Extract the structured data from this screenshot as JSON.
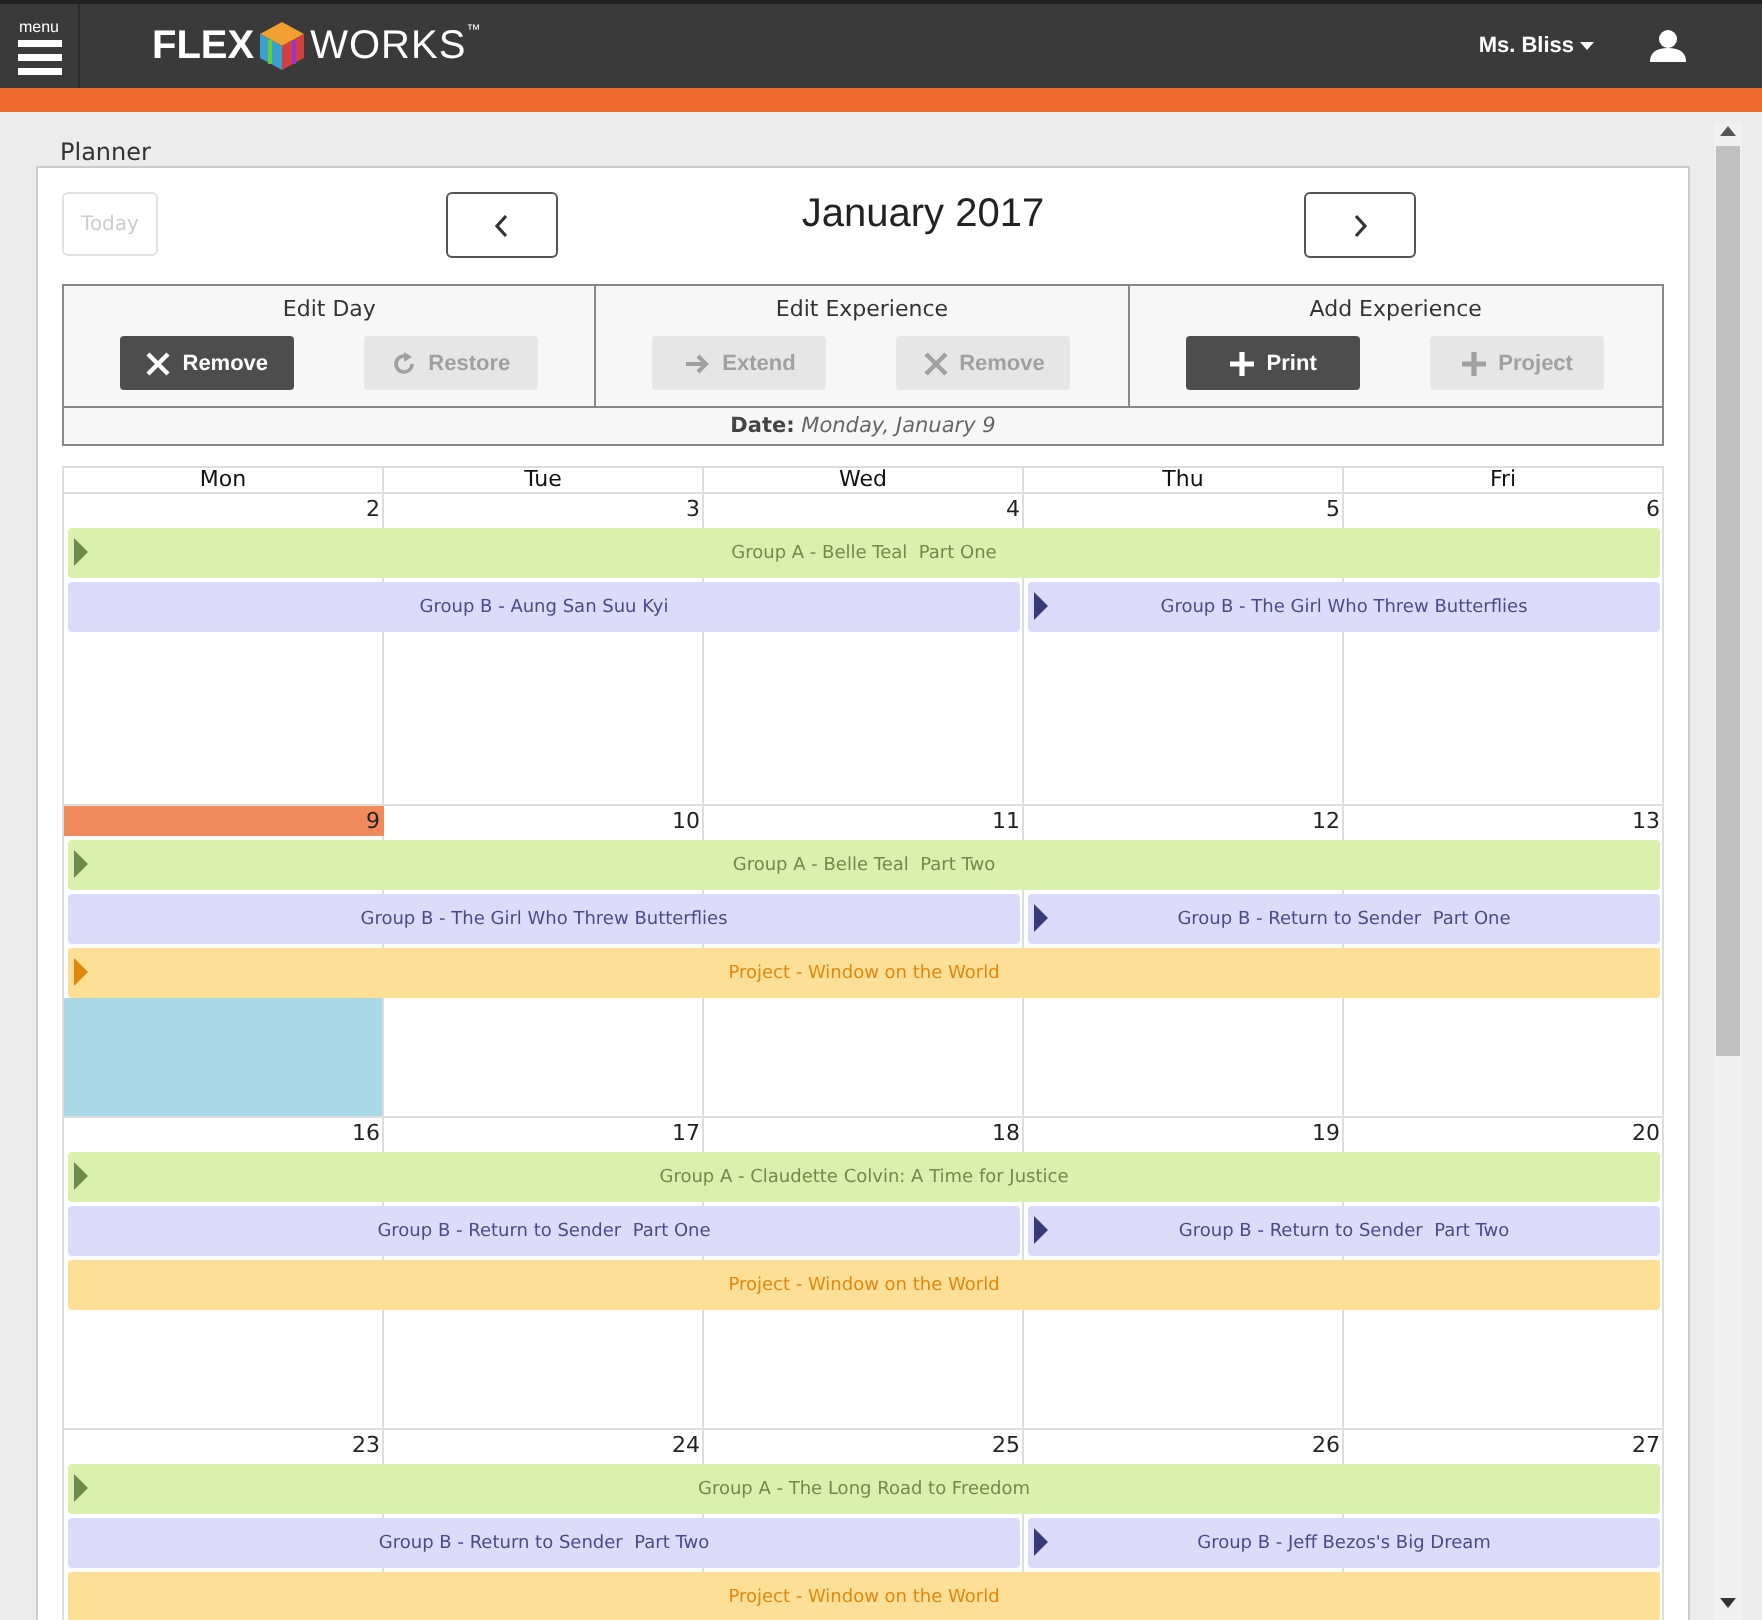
{
  "header": {
    "menu_label": "menu",
    "logo_bold": "FLEX",
    "logo_light": "WORKS",
    "logo_mark": "™",
    "user_name": "Ms. Bliss"
  },
  "page_title": "Planner",
  "toolbar": {
    "today": {
      "label": "Today",
      "disabled": true
    },
    "month": "January 2017"
  },
  "panels": [
    {
      "title": "Edit Day",
      "buttons": [
        {
          "label": "Remove",
          "kind": "remove",
          "disabled": false
        },
        {
          "label": "Restore",
          "kind": "restore",
          "disabled": true
        }
      ]
    },
    {
      "title": "Edit Experience",
      "buttons": [
        {
          "label": "Extend",
          "kind": "extend",
          "disabled": true
        },
        {
          "label": "Remove",
          "kind": "remove",
          "disabled": true
        }
      ]
    },
    {
      "title": "Add Experience",
      "buttons": [
        {
          "label": "Print",
          "kind": "add",
          "disabled": false
        },
        {
          "label": "Project",
          "kind": "add",
          "disabled": true
        }
      ]
    }
  ],
  "date_line": {
    "label": "Date:",
    "value": "Monday, January 9"
  },
  "weekdays": [
    "Mon",
    "Tue",
    "Wed",
    "Thu",
    "Fri"
  ],
  "weeks": [
    {
      "days": [
        {
          "number": "2",
          "selected": false
        },
        {
          "number": "3",
          "selected": false
        },
        {
          "number": "4",
          "selected": false
        },
        {
          "number": "5",
          "selected": false
        },
        {
          "number": "6",
          "selected": false
        }
      ],
      "events": [
        {
          "kind": "group_a",
          "label": "Group A - Belle Teal  Part One",
          "arrow": true
        },
        {
          "kind": "group_b",
          "label": "Group B - Aung San Suu Kyi",
          "arrow": false
        },
        {
          "kind": "group_b",
          "label": "Group B - The Girl Who Threw Butterflies",
          "arrow": true
        }
      ]
    },
    {
      "days": [
        {
          "number": "9",
          "selected": true
        },
        {
          "number": "10",
          "selected": false
        },
        {
          "number": "11",
          "selected": false
        },
        {
          "number": "12",
          "selected": false
        },
        {
          "number": "13",
          "selected": false
        }
      ],
      "events": [
        {
          "kind": "group_a",
          "label": "Group A - Belle Teal  Part Two",
          "arrow": true
        },
        {
          "kind": "group_b",
          "label": "Group B - The Girl Who Threw Butterflies",
          "arrow": false
        },
        {
          "kind": "group_b",
          "label": "Group B - Return to Sender  Part One",
          "arrow": true
        },
        {
          "kind": "project",
          "label": "Project - Window on the World",
          "arrow": true
        }
      ]
    },
    {
      "days": [
        {
          "number": "16",
          "selected": false
        },
        {
          "number": "17",
          "selected": false
        },
        {
          "number": "18",
          "selected": false
        },
        {
          "number": "19",
          "selected": false
        },
        {
          "number": "20",
          "selected": false
        }
      ],
      "events": [
        {
          "kind": "group_a",
          "label": "Group A - Claudette Colvin: A Time for Justice",
          "arrow": true
        },
        {
          "kind": "group_b",
          "label": "Group B - Return to Sender  Part One",
          "arrow": false
        },
        {
          "kind": "group_b",
          "label": "Group B - Return to Sender  Part Two",
          "arrow": true
        },
        {
          "kind": "project",
          "label": "Project - Window on the World",
          "arrow": false
        }
      ]
    },
    {
      "days": [
        {
          "number": "23",
          "selected": false
        },
        {
          "number": "24",
          "selected": false
        },
        {
          "number": "25",
          "selected": false
        },
        {
          "number": "26",
          "selected": false
        },
        {
          "number": "27",
          "selected": false
        }
      ],
      "events": [
        {
          "kind": "group_a",
          "label": "Group A - The Long Road to Freedom",
          "arrow": true
        },
        {
          "kind": "group_b",
          "label": "Group B - Return to Sender  Part Two",
          "arrow": false
        },
        {
          "kind": "group_b",
          "label": "Group B - Jeff Bezos's Big Dream",
          "arrow": true
        },
        {
          "kind": "project",
          "label": "Project - Window on the World",
          "arrow": false
        }
      ]
    }
  ]
}
